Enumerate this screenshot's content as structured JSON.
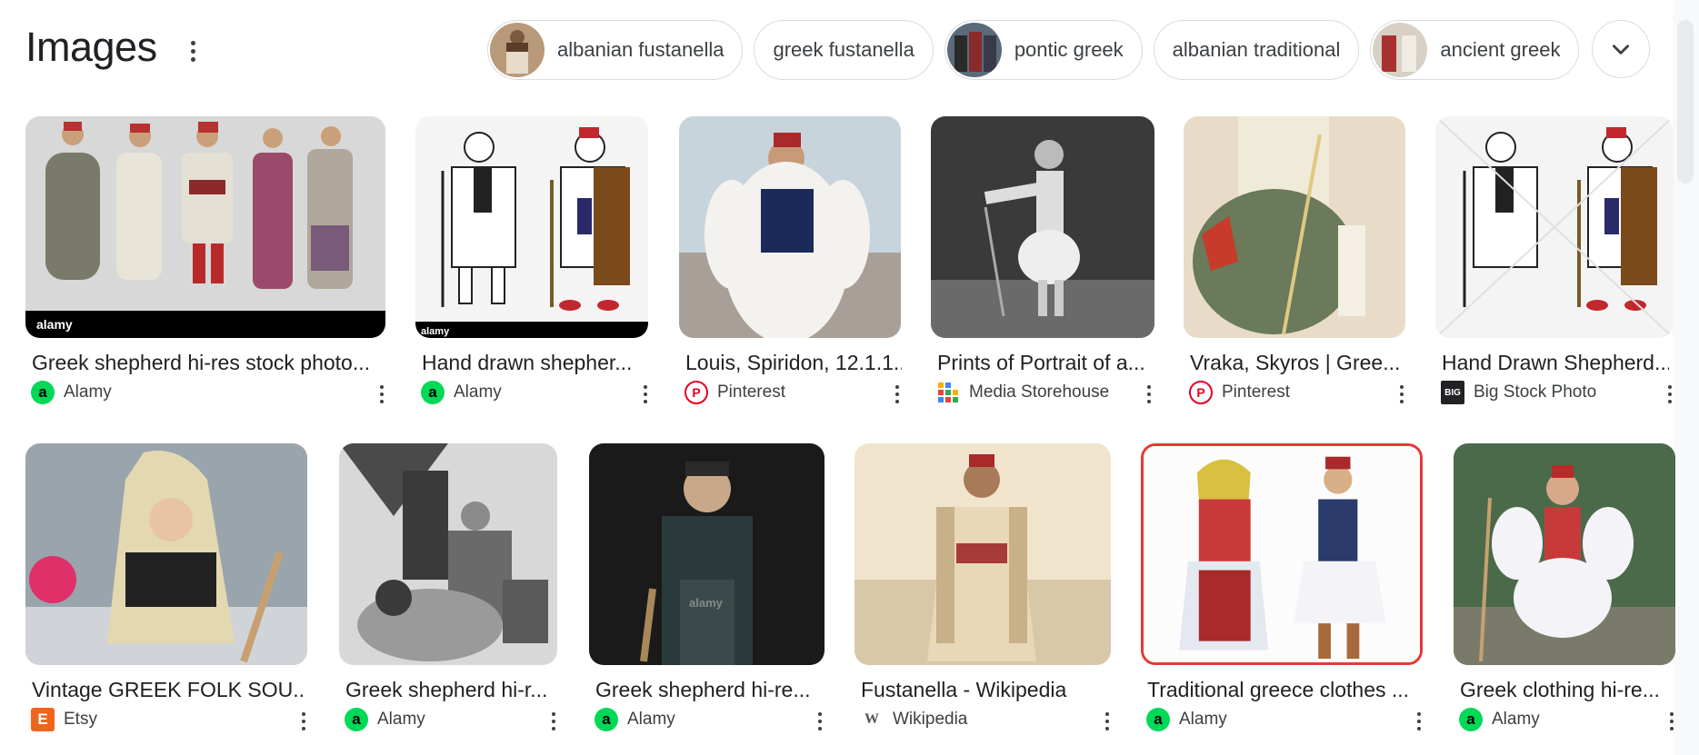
{
  "header": {
    "title": "Images",
    "chips": [
      {
        "label": "albanian fustanella",
        "has_thumb": true
      },
      {
        "label": "greek fustanella",
        "has_thumb": false
      },
      {
        "label": "pontic greek",
        "has_thumb": true
      },
      {
        "label": "albanian traditional",
        "has_thumb": false
      },
      {
        "label": "ancient greek",
        "has_thumb": true
      }
    ],
    "expand_icon": "chevron-down-icon"
  },
  "results": {
    "row1": [
      {
        "caption": "Greek shepherd hi-res stock photo...",
        "source": "Alamy",
        "favicon": "a",
        "favicon_color": "#00d957"
      },
      {
        "caption": "Hand drawn shepher...",
        "source": "Alamy",
        "favicon": "a",
        "favicon_color": "#00d957"
      },
      {
        "caption": "Louis, Spiridon, 12.1.1...",
        "source": "Pinterest",
        "favicon": "P",
        "favicon_color": "#e60023"
      },
      {
        "caption": "Prints of Portrait of a...",
        "source": "Media Storehouse",
        "favicon": "M",
        "favicon_color": "#f4b400"
      },
      {
        "caption": "Vraka, Skyros | Gree...",
        "source": "Pinterest",
        "favicon": "P",
        "favicon_color": "#e60023"
      },
      {
        "caption": "Hand Drawn Shepherd...",
        "source": "Big Stock Photo",
        "favicon": "BIG",
        "favicon_color": "#202124"
      }
    ],
    "row2": [
      {
        "caption": "Vintage GREEK FOLK SOU...",
        "source": "Etsy",
        "favicon": "E",
        "favicon_color": "#f1641e"
      },
      {
        "caption": "Greek shepherd hi-r...",
        "source": "Alamy",
        "favicon": "a",
        "favicon_color": "#00d957"
      },
      {
        "caption": "Greek shepherd hi-re...",
        "source": "Alamy",
        "favicon": "a",
        "favicon_color": "#00d957"
      },
      {
        "caption": "Fustanella - Wikipedia",
        "source": "Wikipedia",
        "favicon": "W",
        "favicon_color": "#ffffff"
      },
      {
        "caption": "Traditional greece clothes ...",
        "source": "Alamy",
        "favicon": "a",
        "favicon_color": "#00d957"
      },
      {
        "caption": "Greek clothing hi-re...",
        "source": "Alamy",
        "favicon": "a",
        "favicon_color": "#00d957"
      }
    ]
  },
  "thumb_text": {
    "alamy": "alamy"
  }
}
